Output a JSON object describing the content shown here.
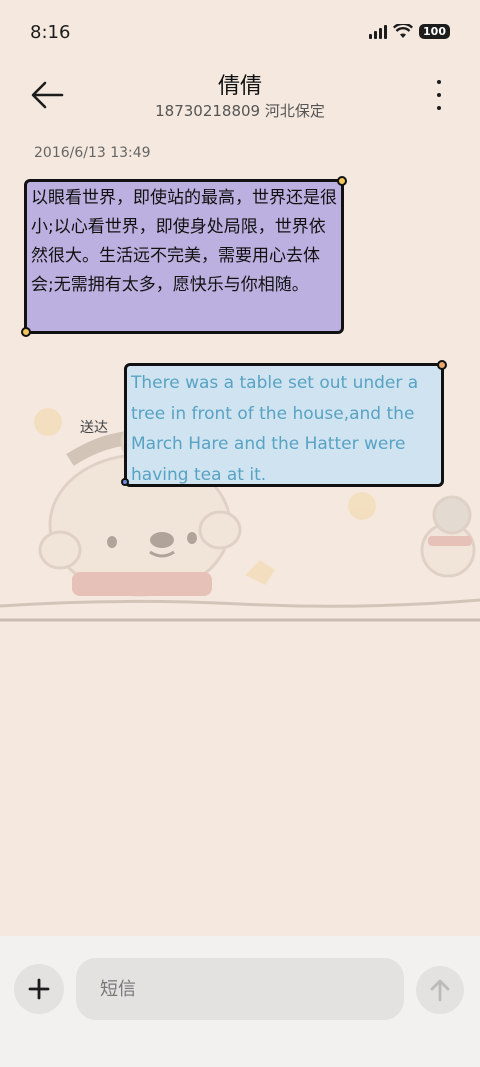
{
  "status_bar": {
    "time": "8:16",
    "battery": "100"
  },
  "header": {
    "title": "倩倩",
    "subtitle": "18730218809 河北保定"
  },
  "thread": {
    "timestamp": "2016/6/13 13:49",
    "incoming_message": "以眼看世界，即使站的最高，世界还是很小;以心看世界，即使身处局限，世界依然很大。生活远不完美，需要用心去体会;无需拥有太多，愿快乐与你相随。",
    "outgoing_message": "There was a table set out under a tree in front of the house,and the March Hare and the Hatter were having tea at it.",
    "delivered_label": "送达"
  },
  "composer": {
    "placeholder": "短信"
  },
  "colors": {
    "background": "#f4e8df",
    "incoming_bubble": "#bcb0e0",
    "outgoing_bubble": "#cfe3f0",
    "outgoing_text": "#58a3c4"
  }
}
